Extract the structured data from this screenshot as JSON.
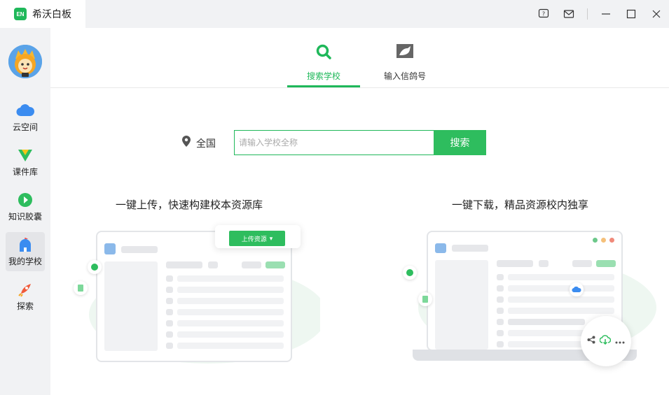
{
  "app": {
    "title": "希沃白板",
    "logo_text": "EN",
    "accent": "#1fb85a"
  },
  "window_controls": [
    "help-icon",
    "mail-icon",
    "minimize-icon",
    "maximize-icon",
    "close-icon"
  ],
  "sidebar": {
    "items": [
      {
        "label": "云空间",
        "icon": "cloud-icon",
        "active": false
      },
      {
        "label": "课件库",
        "icon": "courseware-icon",
        "active": false
      },
      {
        "label": "知识胶囊",
        "icon": "capsule-icon",
        "active": false
      },
      {
        "label": "我的学校",
        "icon": "school-icon",
        "active": true
      },
      {
        "label": "探索",
        "icon": "rocket-icon",
        "active": false
      }
    ]
  },
  "tabs": [
    {
      "label": "搜索学校",
      "icon": "search-icon",
      "active": true
    },
    {
      "label": "输入信鸽号",
      "icon": "pigeon-icon",
      "active": false
    }
  ],
  "search": {
    "region": "全国",
    "placeholder": "请输入学校全称",
    "value": "",
    "button": "搜索"
  },
  "features": [
    {
      "title": "一键上传，快速构建校本资源库",
      "action_label": "上传资源"
    },
    {
      "title": "一键下载，精品资源校内独享"
    }
  ]
}
